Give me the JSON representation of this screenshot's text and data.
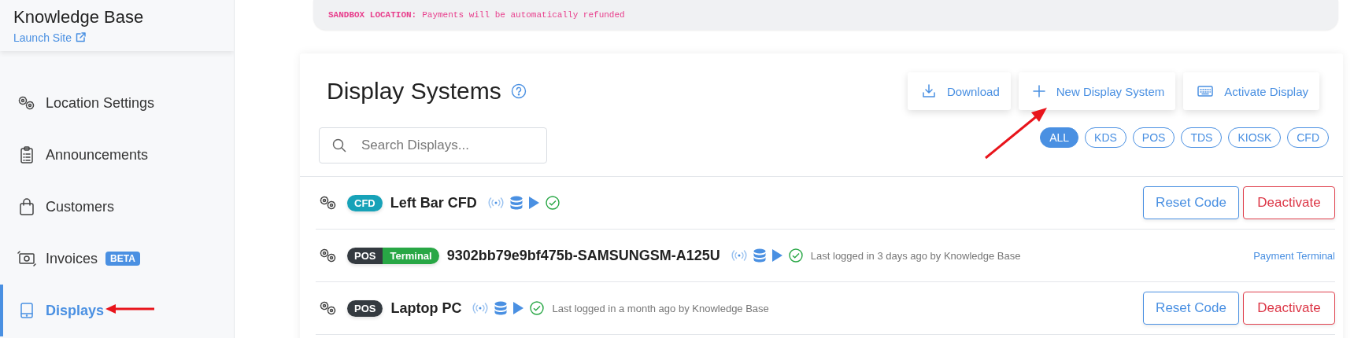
{
  "sidebar": {
    "title": "Knowledge Base",
    "launch_link": "Launch Site",
    "items": [
      {
        "label": "Location Settings",
        "selected": false
      },
      {
        "label": "Announcements",
        "selected": false
      },
      {
        "label": "Customers",
        "selected": false
      },
      {
        "label": "Invoices",
        "badge": "BETA",
        "selected": false
      },
      {
        "label": "Displays",
        "selected": true
      }
    ]
  },
  "banner": {
    "label": "SANDBOX LOCATION:",
    "message": "Payments will be automatically refunded"
  },
  "page": {
    "title": "Display Systems",
    "actions": [
      {
        "label": "Download"
      },
      {
        "label": "New Display System"
      },
      {
        "label": "Activate Display"
      }
    ],
    "search": {
      "placeholder": "Search Displays..."
    },
    "filters": [
      {
        "label": "ALL",
        "selected": true
      },
      {
        "label": "KDS",
        "selected": false
      },
      {
        "label": "POS",
        "selected": false
      },
      {
        "label": "TDS",
        "selected": false
      },
      {
        "label": "KIOSK",
        "selected": false
      },
      {
        "label": "CFD",
        "selected": false
      }
    ]
  },
  "displays": [
    {
      "tags": [
        {
          "label": "CFD",
          "color": "#17a2b8"
        }
      ],
      "name": "Left Bar CFD",
      "actions": [
        {
          "label": "Reset Code",
          "kind": "outline-primary"
        },
        {
          "label": "Deactivate",
          "kind": "outline-danger"
        }
      ]
    },
    {
      "tags": [
        {
          "label": "POS",
          "color": "#343a40"
        },
        {
          "label": "Terminal",
          "color": "#28a745"
        }
      ],
      "name": "9302bb79e9bf475b-SAMSUNGSM-A125U",
      "last_login": "Last logged in 3 days ago by Knowledge Base",
      "actions": [
        {
          "label": "Payment Terminal",
          "kind": "link"
        }
      ]
    },
    {
      "tags": [
        {
          "label": "POS",
          "color": "#343a40"
        }
      ],
      "name": "Laptop PC",
      "last_login": "Last logged in a month ago by Knowledge Base",
      "actions": [
        {
          "label": "Reset Code",
          "kind": "outline-primary"
        },
        {
          "label": "Deactivate",
          "kind": "outline-danger"
        }
      ]
    }
  ]
}
